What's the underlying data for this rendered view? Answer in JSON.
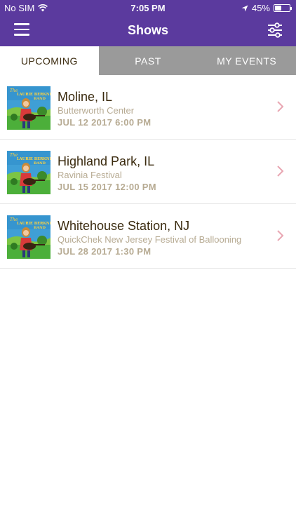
{
  "status_bar": {
    "carrier": "No SIM",
    "time": "7:05 PM",
    "battery_percent": "45%",
    "battery_level": 0.45
  },
  "header": {
    "title": "Shows",
    "menu_icon": "hamburger-menu-icon",
    "filter_icon": "sliders-filter-icon",
    "background_color": "#5b3a9e"
  },
  "tabs": [
    {
      "label": "UPCOMING",
      "active": true
    },
    {
      "label": "PAST",
      "active": false
    },
    {
      "label": "MY EVENTS",
      "active": false
    }
  ],
  "shows": [
    {
      "city": "Moline, IL",
      "venue": "Butterworth Center",
      "date": "JUL 12 2017 6:00 PM"
    },
    {
      "city": "Highland Park, IL",
      "venue": "Ravinia Festival",
      "date": "JUL 15 2017 12:00 PM"
    },
    {
      "city": "Whitehouse Station, NJ",
      "venue": "QuickChek New Jersey Festival of Ballooning",
      "date": "JUL 28 2017 1:30 PM"
    }
  ],
  "thumbnail": {
    "line1": "The",
    "line2": "LAURIE BERKNER",
    "line3": "BAND"
  }
}
